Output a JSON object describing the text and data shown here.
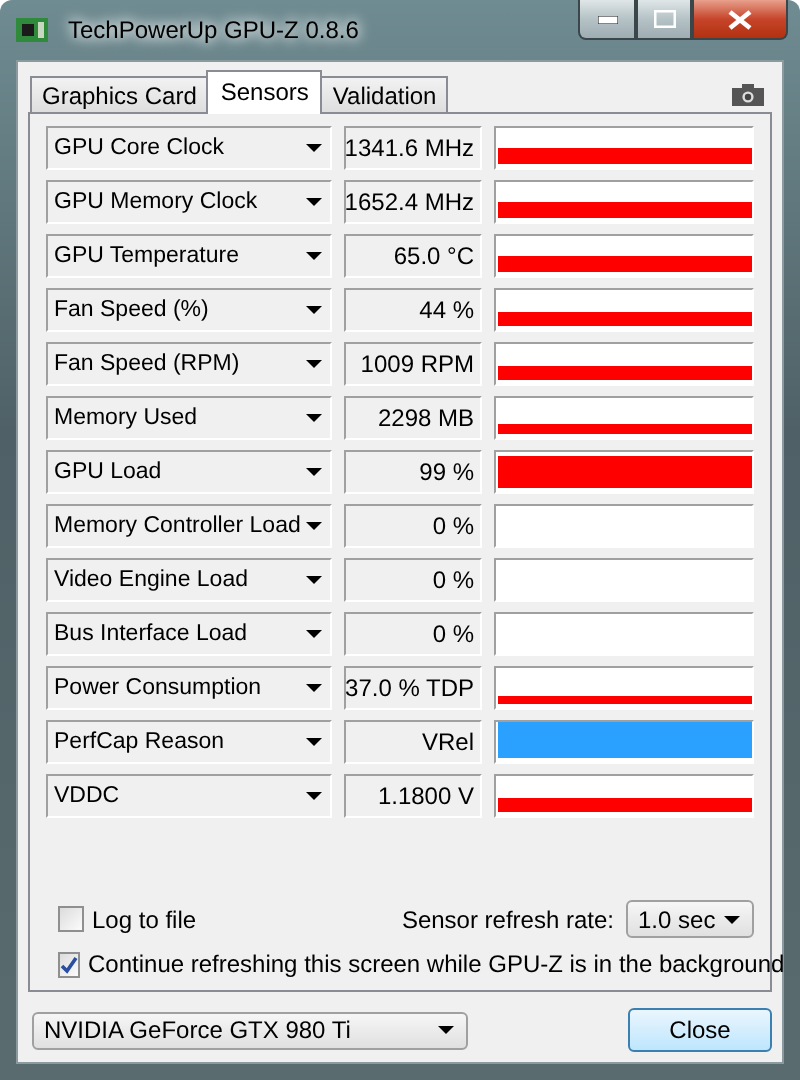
{
  "window": {
    "title": "TechPowerUp GPU-Z 0.8.6"
  },
  "tabs": [
    {
      "label": "Graphics Card",
      "selected": false
    },
    {
      "label": "Sensors",
      "selected": true
    },
    {
      "label": "Validation",
      "selected": false
    }
  ],
  "sensors": [
    {
      "name": "GPU Core Clock",
      "reading": "1341.6 MHz",
      "color": "#ff0000"
    },
    {
      "name": "GPU Memory Clock",
      "reading": "1652.4 MHz",
      "color": "#ff0000"
    },
    {
      "name": "GPU Temperature",
      "reading": "65.0 °C",
      "color": "#ff0000"
    },
    {
      "name": "Fan Speed (%)",
      "reading": "44 %",
      "color": "#ff0000"
    },
    {
      "name": "Fan Speed (RPM)",
      "reading": "1009 RPM",
      "color": "#ff0000"
    },
    {
      "name": "Memory Used",
      "reading": "2298 MB",
      "color": "#ff0000"
    },
    {
      "name": "GPU Load",
      "reading": "99 %",
      "color": "#ff0000"
    },
    {
      "name": "Memory Controller Load",
      "reading": "0 %"
    },
    {
      "name": "Video Engine Load",
      "reading": "0 %"
    },
    {
      "name": "Bus Interface Load",
      "reading": "0 %"
    },
    {
      "name": "Power Consumption",
      "reading": "37.0 % TDP",
      "color": "#ff0000"
    },
    {
      "name": "PerfCap Reason",
      "reading": "VRel",
      "color": "#2aa1ff"
    },
    {
      "name": "VDDC",
      "reading": "1.1800 V",
      "color": "#ff0000"
    }
  ],
  "log_to_file": {
    "label": "Log to file",
    "checked": false
  },
  "refresh_rate": {
    "label": "Sensor refresh rate:",
    "value": "1.0 sec"
  },
  "continue_refreshing": {
    "label": "Continue refreshing this screen while GPU-Z is in the background",
    "checked": true
  },
  "gpu_select": {
    "value": "NVIDIA GeForce GTX 980 Ti"
  },
  "close_button": {
    "label": "Close"
  }
}
